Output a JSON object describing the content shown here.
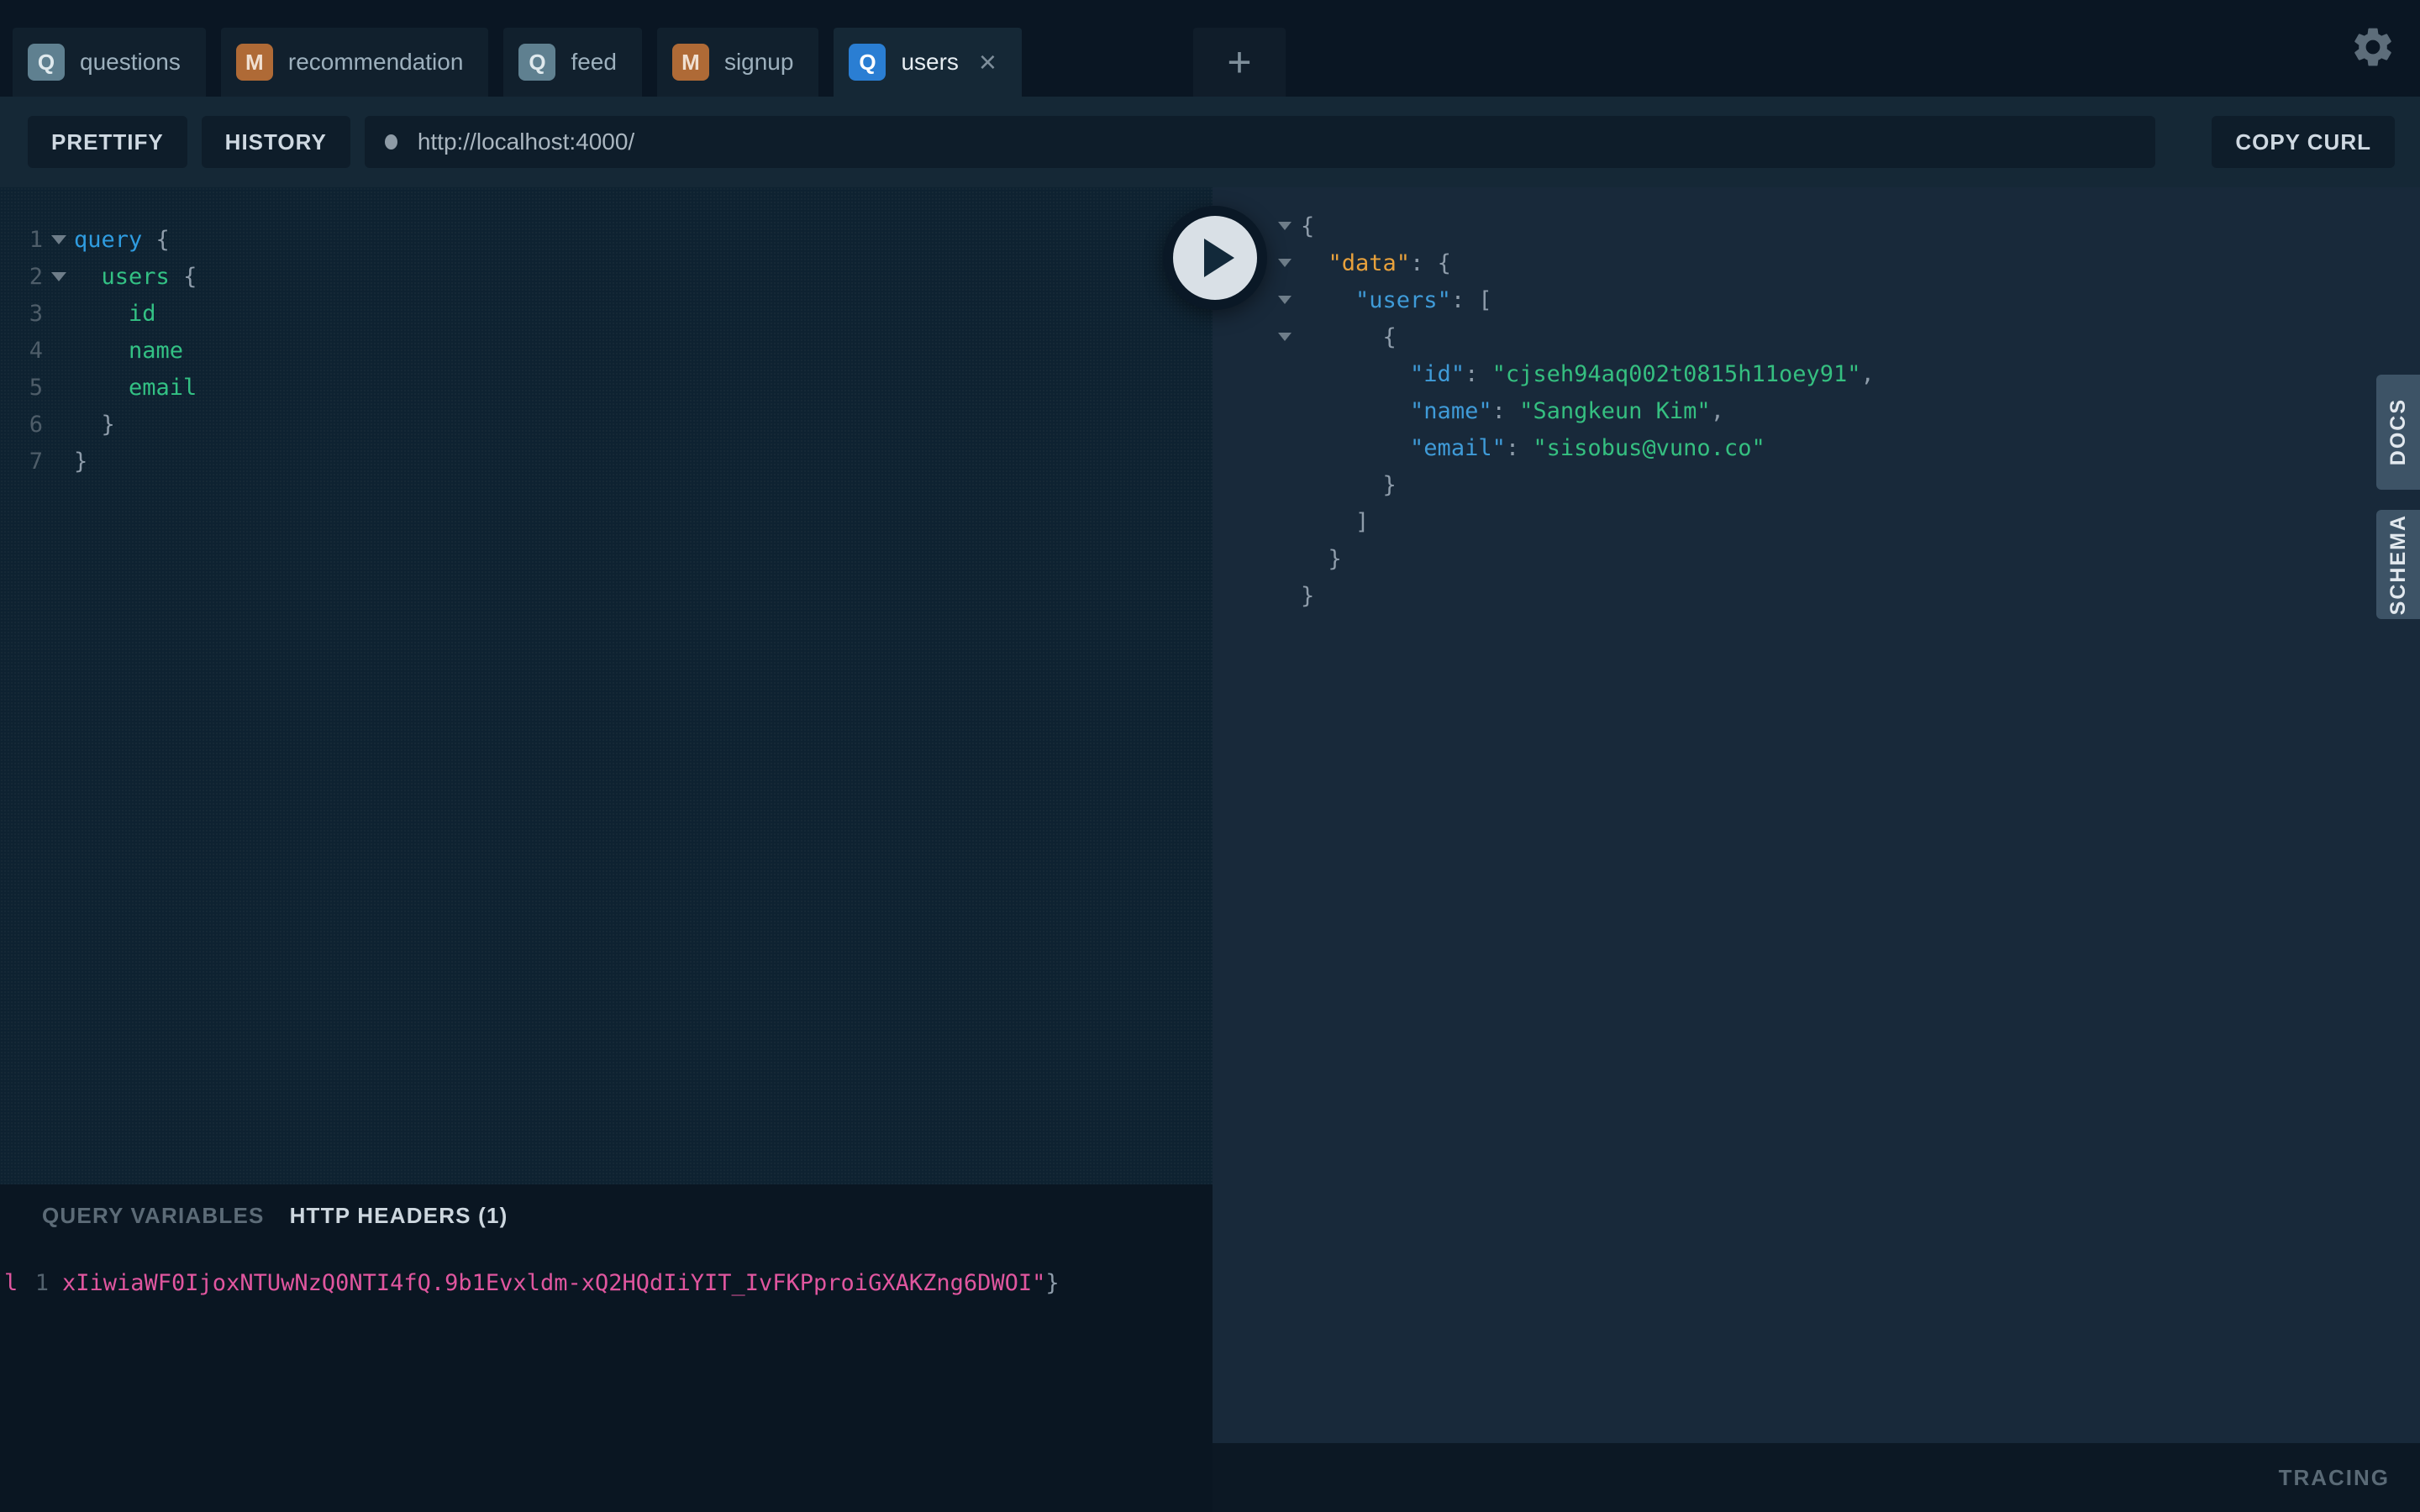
{
  "colors": {
    "top_bar_bg": "#0a1623",
    "inactive_tab_bg": "#11202d",
    "active_panel_bg": "#152836",
    "editor_bg": "#0e2231",
    "result_bg": "#18293a",
    "side_tab_bg": "#3d5366",
    "query_badge": "#5f8090",
    "mutation_badge": "#af6a36",
    "active_query_badge": "#2a7ed3",
    "keyword_blue": "#2f9ce0",
    "field_green": "#33c184",
    "key_blue": "#3f9bd8",
    "root_key_orange": "#e8a13c",
    "string_green": "#35bf80",
    "header_pink": "#e0569f"
  },
  "icons": {
    "gear": "gear-icon",
    "close": "×",
    "plus": "+",
    "play": "play-triangle",
    "fold": "chevron-down",
    "url_dot": "status-dot"
  },
  "tabs": {
    "items": [
      {
        "badge": "Q",
        "badge_class": "q",
        "label": "questions"
      },
      {
        "badge": "M",
        "badge_class": "m",
        "label": "recommendation"
      },
      {
        "badge": "Q",
        "badge_class": "q",
        "label": "feed"
      },
      {
        "badge": "M",
        "badge_class": "m",
        "label": "signup"
      },
      {
        "badge": "Q",
        "badge_class": "q-active",
        "label": "users",
        "active": true,
        "closable": true
      }
    ]
  },
  "toolbar": {
    "prettify_label": "PRETTIFY",
    "history_label": "HISTORY",
    "url_value": "http://localhost:4000/",
    "copy_curl_label": "COPY CURL"
  },
  "query_editor": {
    "lines": [
      {
        "num": "1",
        "fold": true,
        "tokens": [
          {
            "t": "query ",
            "c": "kw"
          },
          {
            "t": "{",
            "c": "pun"
          }
        ]
      },
      {
        "num": "2",
        "fold": true,
        "tokens": [
          {
            "t": "  ",
            "c": "pln"
          },
          {
            "t": "users ",
            "c": "field"
          },
          {
            "t": "{",
            "c": "pun"
          }
        ]
      },
      {
        "num": "3",
        "tokens": [
          {
            "t": "    ",
            "c": "pln"
          },
          {
            "t": "id",
            "c": "field"
          }
        ]
      },
      {
        "num": "4",
        "tokens": [
          {
            "t": "    ",
            "c": "pln"
          },
          {
            "t": "name",
            "c": "field"
          }
        ]
      },
      {
        "num": "5",
        "tokens": [
          {
            "t": "    ",
            "c": "pln"
          },
          {
            "t": "email",
            "c": "field"
          }
        ]
      },
      {
        "num": "6",
        "tokens": [
          {
            "t": "  ",
            "c": "pln"
          },
          {
            "t": "}",
            "c": "pun"
          }
        ]
      },
      {
        "num": "7",
        "tokens": [
          {
            "t": "}",
            "c": "pun"
          }
        ]
      }
    ]
  },
  "response": {
    "lines": [
      {
        "fold": true,
        "tokens": [
          {
            "t": "{",
            "c": "pun"
          }
        ]
      },
      {
        "fold": true,
        "tokens": [
          {
            "t": "  ",
            "c": "pln"
          },
          {
            "t": "\"data\"",
            "c": "keyroot"
          },
          {
            "t": ": ",
            "c": "pun"
          },
          {
            "t": "{",
            "c": "pun"
          }
        ]
      },
      {
        "fold": true,
        "tokens": [
          {
            "t": "    ",
            "c": "pln"
          },
          {
            "t": "\"users\"",
            "c": "key"
          },
          {
            "t": ": ",
            "c": "pun"
          },
          {
            "t": "[",
            "c": "pun"
          }
        ]
      },
      {
        "fold": true,
        "tokens": [
          {
            "t": "      ",
            "c": "pln"
          },
          {
            "t": "{",
            "c": "pun"
          }
        ]
      },
      {
        "tokens": [
          {
            "t": "        ",
            "c": "pln"
          },
          {
            "t": "\"id\"",
            "c": "key"
          },
          {
            "t": ": ",
            "c": "pun"
          },
          {
            "t": "\"cjseh94aq002t0815h11oey91\"",
            "c": "str"
          },
          {
            "t": ",",
            "c": "pun"
          }
        ]
      },
      {
        "tokens": [
          {
            "t": "        ",
            "c": "pln"
          },
          {
            "t": "\"name\"",
            "c": "key"
          },
          {
            "t": ": ",
            "c": "pun"
          },
          {
            "t": "\"Sangkeun Kim\"",
            "c": "str"
          },
          {
            "t": ",",
            "c": "pun"
          }
        ]
      },
      {
        "tokens": [
          {
            "t": "        ",
            "c": "pln"
          },
          {
            "t": "\"email\"",
            "c": "key"
          },
          {
            "t": ": ",
            "c": "pun"
          },
          {
            "t": "\"sisobus@vuno.co\"",
            "c": "str"
          }
        ]
      },
      {
        "tokens": [
          {
            "t": "      }",
            "c": "pun"
          }
        ]
      },
      {
        "tokens": [
          {
            "t": "    ]",
            "c": "pun"
          }
        ]
      },
      {
        "tokens": [
          {
            "t": "  }",
            "c": "pun"
          }
        ]
      },
      {
        "tokens": [
          {
            "t": "}",
            "c": "pun"
          }
        ]
      }
    ]
  },
  "bottom_panel": {
    "query_variables_label": "QUERY VARIABLES",
    "http_headers_label": "HTTP HEADERS (1)",
    "headers_line": {
      "overflow_char": "l",
      "line_number": "1",
      "value": "xIiwiaWF0IjoxNTUwNzQ0NTI4fQ.9b1Evxldm-xQ2HQdIiYIT_IvFKPproiGXAKZng6DWOI\"",
      "closing_brace": "}"
    }
  },
  "side_tabs": {
    "docs_label": "DOCS",
    "schema_label": "SCHEMA"
  },
  "tracing": {
    "label": "TRACING"
  }
}
